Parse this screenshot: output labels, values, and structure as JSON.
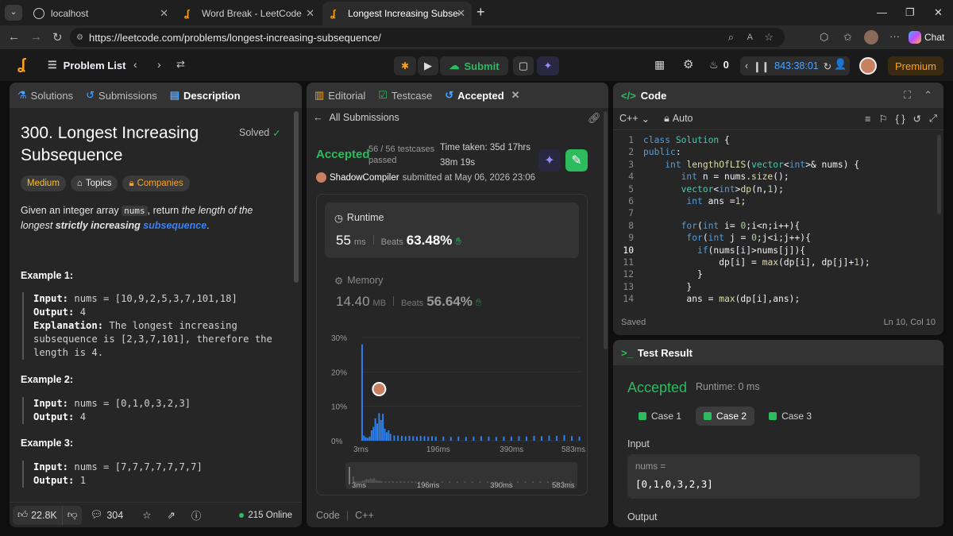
{
  "browser": {
    "tabs": [
      {
        "title": "localhost"
      },
      {
        "title": "Word Break - LeetCode"
      },
      {
        "title": "Longest Increasing Subsequence -"
      }
    ],
    "url": "https://leetcode.com/problems/longest-increasing-subsequence/",
    "chat_label": "Chat"
  },
  "app": {
    "problem_list": "Problem List",
    "submit": "Submit",
    "fire_count": "0",
    "timer": "843:38:01",
    "premium": "Premium"
  },
  "left": {
    "tabs": {
      "solutions": "Solutions",
      "submissions": "Submissions",
      "description": "Description"
    },
    "title_line1": "300. Longest Increasing",
    "title_line2": "Subsequence",
    "solved": "Solved",
    "chips": {
      "difficulty": "Medium",
      "topics": "Topics",
      "companies": "Companies"
    },
    "desc": {
      "p1": "Given an integer array ",
      "code": "nums",
      "p2": ", return ",
      "p3": "the length of the longest",
      "p4": "strictly increasing",
      "p5": "subsequence",
      "p6": "."
    },
    "examples": [
      {
        "title": "Example 1:",
        "input_label": "Input:",
        "input": "nums = [10,9,2,5,3,7,101,18]",
        "output_label": "Output:",
        "output": "4",
        "expl_label": "Explanation:",
        "expl1": "The longest increasing",
        "expl2": "subsequence is [2,3,7,101], therefore the",
        "expl3": "length is 4."
      },
      {
        "title": "Example 2:",
        "input_label": "Input:",
        "input": "nums = [0,1,0,3,2,3]",
        "output_label": "Output:",
        "output": "4"
      },
      {
        "title": "Example 3:",
        "input_label": "Input:",
        "input": "nums = [7,7,7,7,7,7,7]",
        "output_label": "Output:",
        "output": "1"
      }
    ],
    "footer": {
      "likes": "22.8K",
      "comments": "304",
      "online": "215 Online"
    }
  },
  "middle": {
    "tabs": {
      "editorial": "Editorial",
      "testcase": "Testcase",
      "accepted": "Accepted"
    },
    "all_submissions": "All Submissions",
    "status": "Accepted",
    "passed1": "56 / 56 testcases",
    "passed2": "passed",
    "time_taken1": "Time taken: 35d 17hrs",
    "time_taken2": "38m 19s",
    "user": "ShadowCompiler",
    "submitted": "submitted at May 06, 2026 23:06",
    "runtime_label": "Runtime",
    "runtime_value": "55",
    "runtime_unit": "ms",
    "beats_label": "Beats",
    "runtime_beats": "63.48%",
    "memory_label": "Memory",
    "memory_value": "14.40",
    "memory_unit": "MB",
    "memory_beats": "56.64%",
    "footer_code": "Code",
    "footer_lang": "C++"
  },
  "chart_data": {
    "type": "bar",
    "x_tick_labels": [
      "3ms",
      "196ms",
      "390ms",
      "583ms"
    ],
    "y_tick_labels": [
      "30%",
      "20%",
      "10%",
      "0%"
    ],
    "ylim": [
      0,
      30
    ],
    "xlim": [
      3,
      583
    ],
    "series": [
      {
        "x": [
          5,
          10,
          15,
          20,
          25,
          30,
          35,
          40,
          45,
          50,
          55,
          60,
          65,
          70,
          75,
          80,
          90,
          100,
          110,
          120,
          130,
          140,
          150,
          160,
          170,
          180,
          190,
          200,
          220,
          240,
          260,
          280,
          300,
          320,
          340,
          360,
          380,
          400,
          420,
          440,
          460,
          480,
          500,
          520,
          540,
          560,
          580
        ],
        "values": [
          28,
          1.5,
          1,
          0.8,
          1.2,
          3,
          4,
          6.5,
          5,
          8,
          6,
          7.8,
          3.5,
          2.5,
          3,
          2,
          1.5,
          1.5,
          1.4,
          1.3,
          1.4,
          1.3,
          1.2,
          1.4,
          1.3,
          1.2,
          1.3,
          1.2,
          1.2,
          1.1,
          1.2,
          1.1,
          1.2,
          1.3,
          1.2,
          1.1,
          1.2,
          1.2,
          1.3,
          1.2,
          1.4,
          1.3,
          1.5,
          1.4,
          1.6,
          1.3,
          1.2
        ]
      }
    ],
    "marker_x": 50
  },
  "right": {
    "code_tab": "Code",
    "lang": "C++",
    "auto": "Auto",
    "code": [
      "class Solution {",
      "public:",
      "    int lengthOfLIS(vector<int>& nums) {",
      "       int n = nums.size();",
      "       vector<int>dp(n,1);",
      "        int ans =1;",
      "",
      "       for(int i= 0;i<n;i++){",
      "        for(int j = 0;j<i;j++){",
      "          if(nums[i]>nums[j]){",
      "              dp[i] = max(dp[i], dp[j]+1);",
      "          }",
      "        }",
      "        ans = max(dp[i],ans);"
    ],
    "saved": "Saved",
    "cursor": "Ln 10, Col 10",
    "test_result": "Test Result",
    "result_status": "Accepted",
    "result_runtime": "Runtime: 0 ms",
    "cases": [
      "Case 1",
      "Case 2",
      "Case 3"
    ],
    "input_label": "Input",
    "var_name": "nums =",
    "var_value": "[0,1,0,3,2,3]",
    "output_label": "Output"
  },
  "colors": {
    "accent_green": "#2cbb5d",
    "medium": "#ffc01e",
    "link_blue": "#3b82f6",
    "premium_bg": "#3a2a12",
    "premium_text": "#ffa116"
  }
}
